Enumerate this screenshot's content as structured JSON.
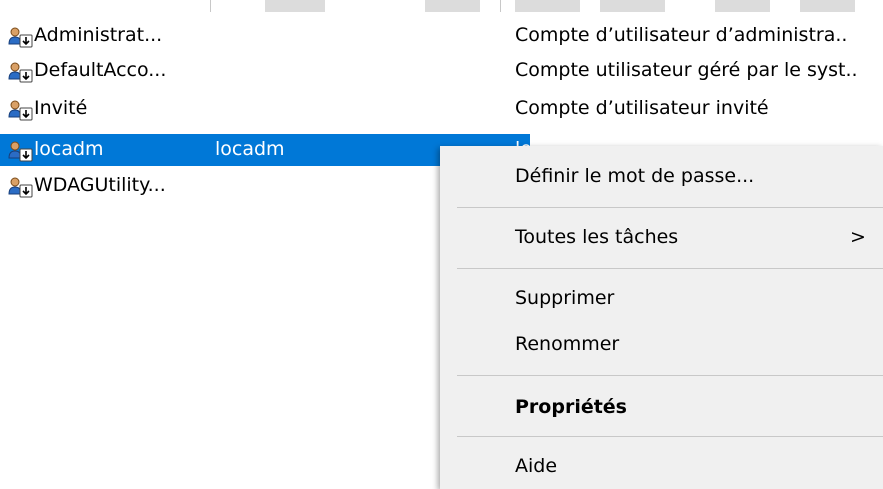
{
  "users": [
    {
      "name": "Administrat...",
      "full_name": "",
      "description": "Compte d’utilisateur d’administra..",
      "selected": false
    },
    {
      "name": "DefaultAcco...",
      "full_name": "",
      "description": "Compte utilisateur géré par le syst..",
      "selected": false
    },
    {
      "name": "Invité",
      "full_name": "",
      "description": "Compte d’utilisateur invité",
      "selected": false
    },
    {
      "name": "locadm",
      "full_name": "locadm",
      "description": "locadm",
      "selected": true
    },
    {
      "name": "WDAGUtility...",
      "full_name": "",
      "description": "",
      "selected": false
    }
  ],
  "icon": "user-account-icon",
  "accent_color": "#0078d7",
  "context_menu": {
    "set_password": "Définir le mot de passe...",
    "all_tasks": "Toutes les tâches",
    "all_tasks_arrow": ">",
    "delete": "Supprimer",
    "rename": "Renommer",
    "properties": "Propriétés",
    "help": "Aide"
  }
}
